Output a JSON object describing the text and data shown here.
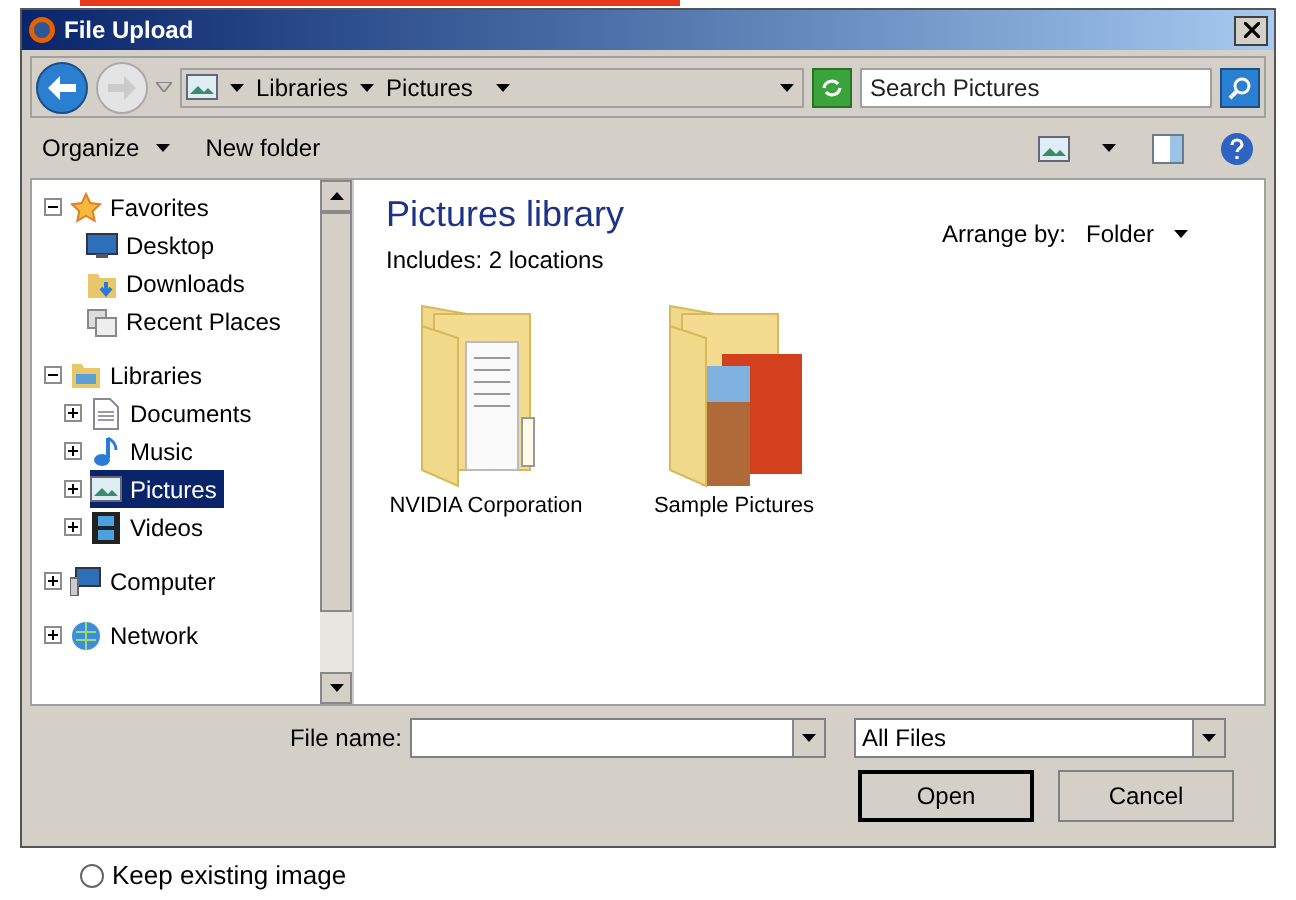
{
  "window": {
    "title": "File Upload"
  },
  "address": {
    "crumbs": [
      "Libraries",
      "Pictures"
    ]
  },
  "search": {
    "placeholder": "Search Pictures"
  },
  "toolbar": {
    "organize": "Organize",
    "new_folder": "New folder"
  },
  "sidebar": {
    "items": [
      {
        "label": "Favorites",
        "kind": "favorites",
        "expanded": true,
        "selected": false,
        "children": [
          {
            "label": "Desktop",
            "kind": "desktop",
            "selected": false
          },
          {
            "label": "Downloads",
            "kind": "downloads",
            "selected": false
          },
          {
            "label": "Recent Places",
            "kind": "recent",
            "selected": false
          }
        ]
      },
      {
        "label": "Libraries",
        "kind": "libraries",
        "expanded": true,
        "selected": false,
        "children": [
          {
            "label": "Documents",
            "kind": "documents",
            "expanded": false,
            "selected": false
          },
          {
            "label": "Music",
            "kind": "music",
            "expanded": false,
            "selected": false
          },
          {
            "label": "Pictures",
            "kind": "pictures",
            "expanded": false,
            "selected": true
          },
          {
            "label": "Videos",
            "kind": "videos",
            "expanded": false,
            "selected": false
          }
        ]
      },
      {
        "label": "Computer",
        "kind": "computer",
        "expanded": false,
        "selected": false
      },
      {
        "label": "Network",
        "kind": "network",
        "expanded": false,
        "selected": false
      }
    ]
  },
  "content": {
    "title": "Pictures library",
    "subtitle": "Includes:  2 locations",
    "arrange_label": "Arrange by:",
    "arrange_value": "Folder",
    "folders": [
      {
        "name": "NVIDIA Corporation",
        "kind": "documents"
      },
      {
        "name": "Sample Pictures",
        "kind": "pictures"
      }
    ]
  },
  "footer": {
    "file_name_label": "File name:",
    "file_type": "All Files",
    "buttons": [
      "Open",
      "Cancel"
    ]
  },
  "page": {
    "option": {
      "label": "Keep existing image",
      "selected": false
    }
  }
}
